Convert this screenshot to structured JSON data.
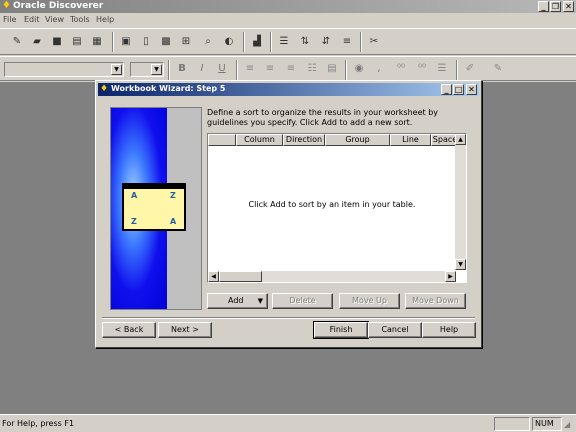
{
  "app": {
    "title": "Oracle Discoverer"
  },
  "window_controls": {
    "minimize": "_",
    "restore": "❐",
    "close": "✕"
  },
  "menu": [
    "File",
    "Edit",
    "View",
    "Tools",
    "Help"
  ],
  "toolbar2": {
    "bold": "B",
    "italic": "I",
    "underline": "U",
    "comma": ","
  },
  "dialog": {
    "title": "Workbook Wizard: Step 5",
    "description": "Define a sort to organize the results in your worksheet by guidelines you specify. Click Add to add a new sort.",
    "columns": [
      "Column",
      "Direction",
      "Group",
      "Line",
      "Space"
    ],
    "empty_message": "Click Add to sort by an item in your table.",
    "buttons": {
      "add": "Add",
      "delete": "Delete",
      "move_up": "Move Up",
      "move_down": "Move Down",
      "back": "< Back",
      "next": "Next >",
      "finish": "Finish",
      "cancel": "Cancel",
      "help": "Help"
    },
    "graphic_letters": [
      "A",
      "Z",
      "Z",
      "A"
    ]
  },
  "status": {
    "message": "For Help, press F1",
    "num": "NUM"
  }
}
